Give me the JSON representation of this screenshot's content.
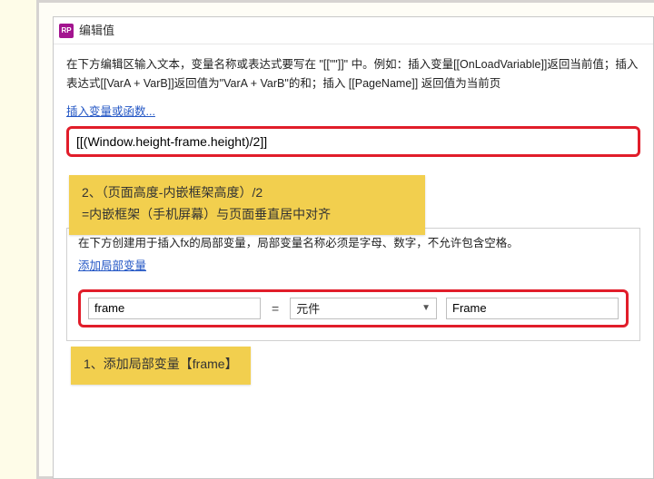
{
  "titlebar": {
    "icon_text": "RP",
    "title": "编辑值"
  },
  "instructions": "在下方编辑区输入文本，变量名称或表达式要写在 \"[[\"\"]]\" 中。例如：插入变量[[OnLoadVariable]]返回当前值；插入表达式[[VarA + VarB]]返回值为\"VarA + VarB\"的和；插入 [[PageName]] 返回值为当前页",
  "insert_link": "插入变量或函数...",
  "expression_value": "[[(Window.height-frame.height)/2]]",
  "annotation_top_line1": "2、（页面高度-内嵌框架高度）/2",
  "annotation_top_line2": "=内嵌框架（手机屏幕）与页面垂直居中对齐",
  "sub_instructions": "在下方创建用于插入fx的局部变量，局部变量名称必须是字母、数字，不允许包含空格。",
  "add_local_link": "添加局部变量",
  "row": {
    "var_name": "frame",
    "eq": "=",
    "type_label": "元件",
    "target": "Frame"
  },
  "annotation_bottom": "1、添加局部变量【frame】"
}
